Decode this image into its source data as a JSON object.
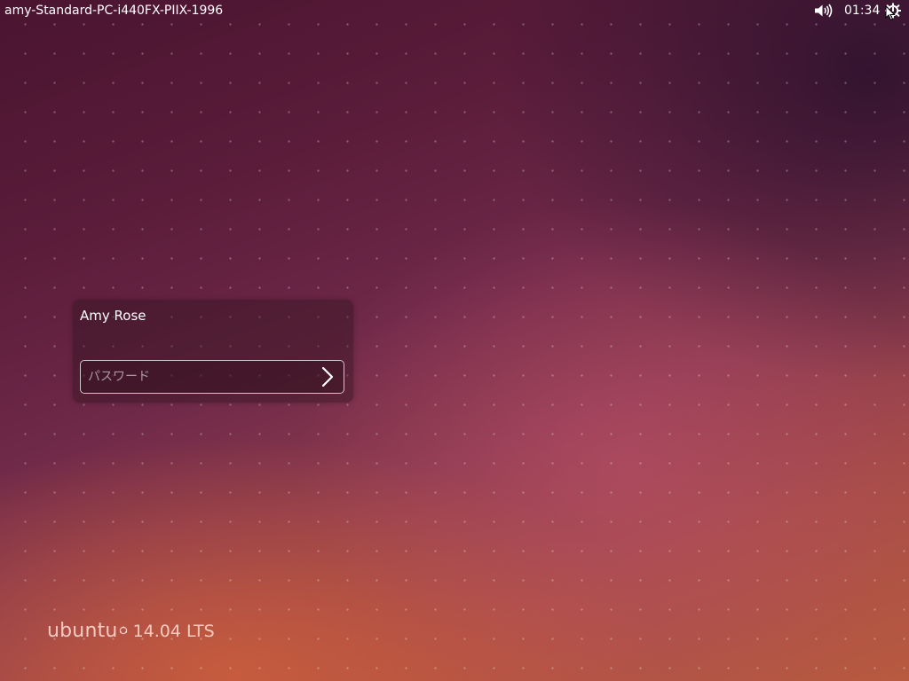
{
  "panel": {
    "hostname": "amy-Standard-PC-i440FX-PIIX-1996",
    "clock": "01:34",
    "volume_icon": "volume-high-icon",
    "power_icon": "power-gear-icon"
  },
  "login": {
    "user_name": "Amy Rose",
    "password_placeholder": "パスワード",
    "password_value": "",
    "submit_icon": "chevron-right-icon"
  },
  "branding": {
    "word": "ubuntu",
    "version": "14.04 LTS"
  },
  "colors": {
    "panel_text": "#ffffff",
    "background_dark": "#4a1430",
    "background_warm": "#b85a40",
    "brand_text": "#ffe1d7"
  }
}
